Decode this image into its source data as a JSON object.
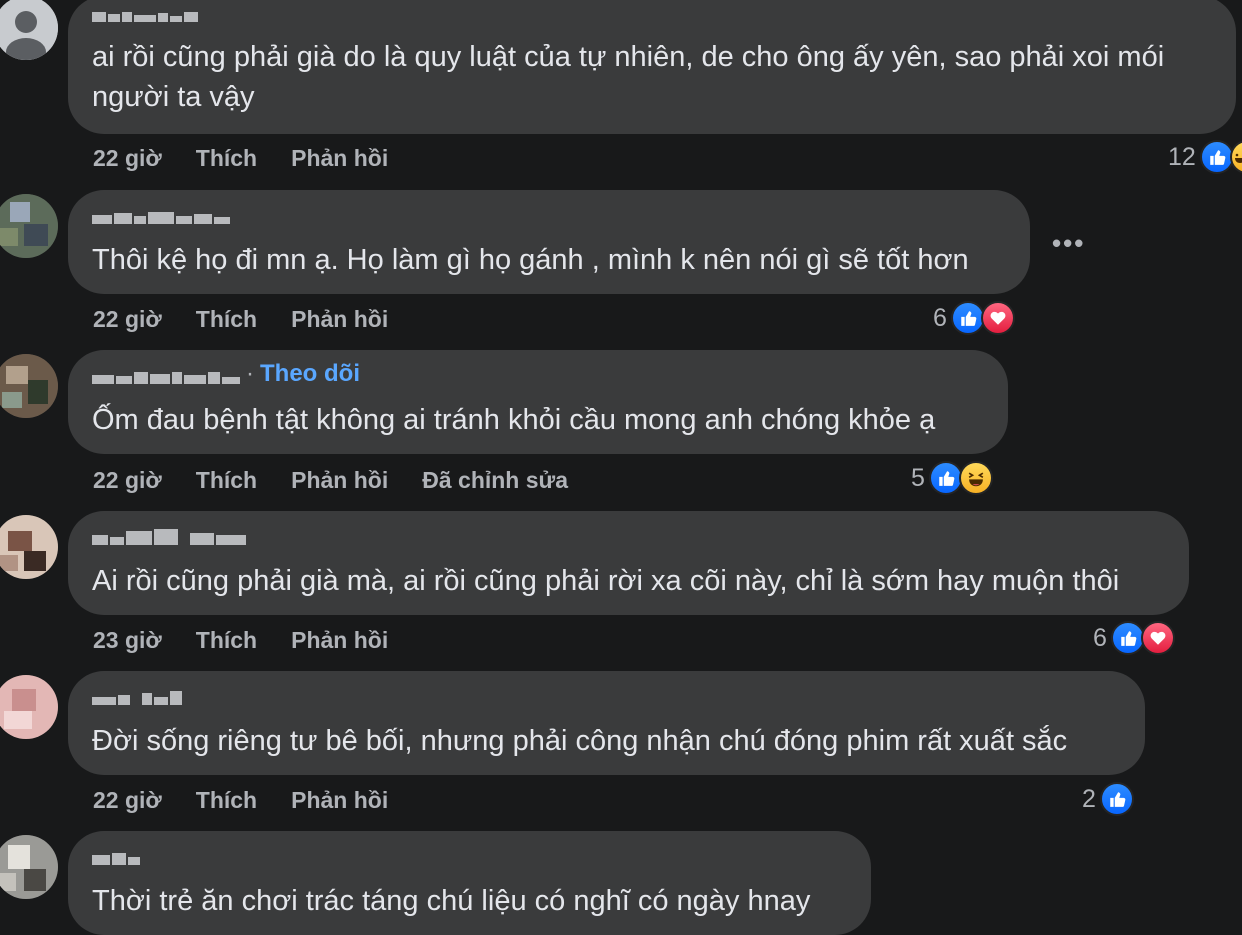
{
  "comments": [
    {
      "text_lines": [
        "ai rồi cũng phải già do là quy luật của tự nhiên, de cho ông ấy yên, sao phải xoi mói",
        "người ta vậy"
      ],
      "time": "22 giờ",
      "like": "Thích",
      "reply": "Phản hồi",
      "reaction_count": "12",
      "reactions": [
        "like-icon",
        "haha-icon"
      ]
    },
    {
      "text_lines": [
        "Thôi kệ họ đi mn ạ. Họ làm gì họ gánh , mình k nên nói gì sẽ tốt hơn"
      ],
      "time": "22 giờ",
      "like": "Thích",
      "reply": "Phản hồi",
      "more": "•••",
      "reaction_count": "6",
      "reactions": [
        "like-icon",
        "love-icon"
      ]
    },
    {
      "text_lines": [
        "Ốm đau bệnh tật không ai tránh khỏi cầu mong anh chóng khỏe ạ"
      ],
      "follow": "Theo dõi",
      "time": "22 giờ",
      "like": "Thích",
      "reply": "Phản hồi",
      "edited": "Đã chỉnh sửa",
      "reaction_count": "5",
      "reactions": [
        "like-icon",
        "haha-icon"
      ]
    },
    {
      "text_lines": [
        "Ai rồi cũng phải già mà, ai rồi cũng phải rời xa cõi này, chỉ là sớm hay muộn thôi"
      ],
      "time": "23 giờ",
      "like": "Thích",
      "reply": "Phản hồi",
      "reaction_count": "6",
      "reactions": [
        "like-icon",
        "love-icon"
      ]
    },
    {
      "text_lines": [
        "Đời sống riêng tư bê bối, nhưng phải công nhận chú đóng phim rất xuất sắc"
      ],
      "time": "22 giờ",
      "like": "Thích",
      "reply": "Phản hồi",
      "reaction_count": "2",
      "reactions": [
        "like-icon"
      ]
    },
    {
      "text_lines": [
        "Thời trẻ ăn chơi trác táng chú liệu có nghĩ có ngày hnay"
      ]
    }
  ],
  "colors": {
    "background": "#18191a",
    "bubble": "#3a3b3c",
    "meta_text": "#b0b3b8",
    "link_blue": "#5aa7ff",
    "like_blue": "#0866ff",
    "love_red": "#e41e3f"
  }
}
